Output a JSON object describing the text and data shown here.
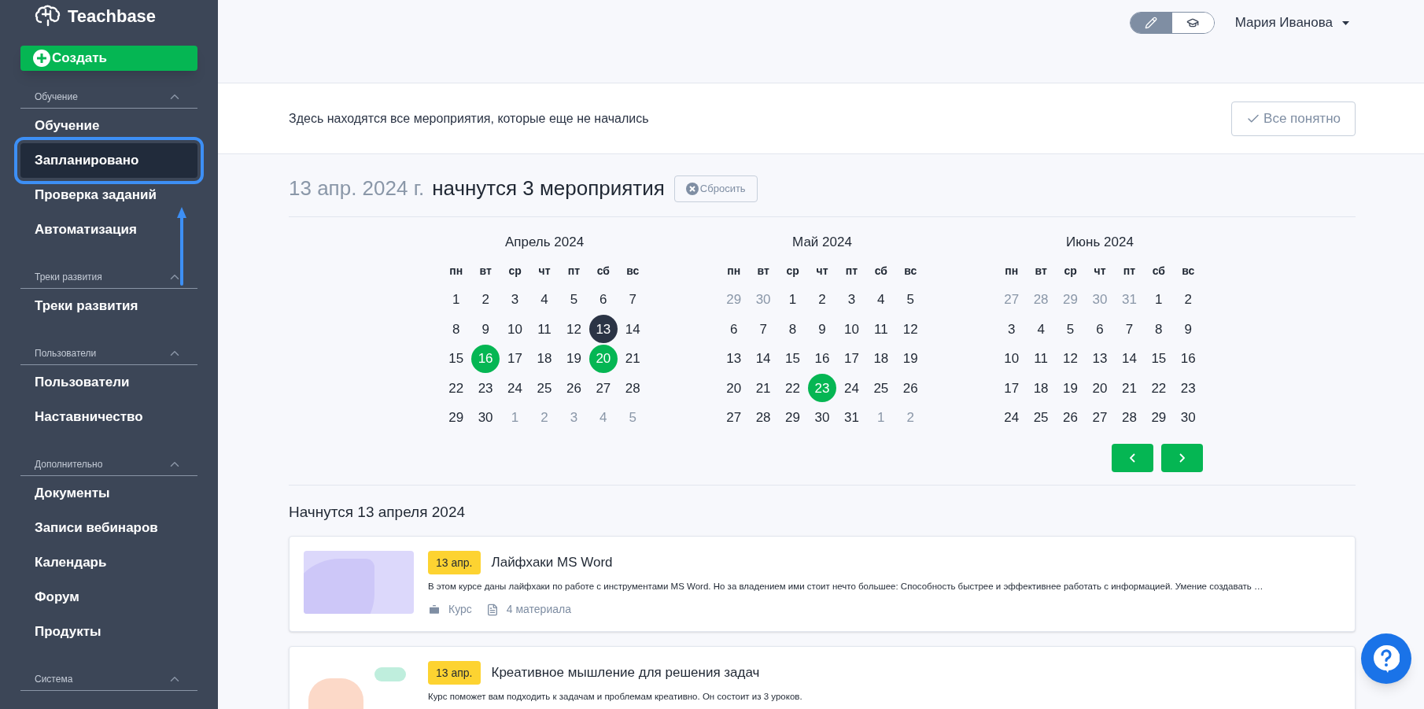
{
  "sidebar": {
    "brand": "Teachbase",
    "create_button": "Создать",
    "sections": [
      {
        "title": "Обучение",
        "expanded": true,
        "items": [
          {
            "label": "Обучение",
            "selected": false
          },
          {
            "label": "Запланировано",
            "selected": true
          },
          {
            "label": "Проверка заданий",
            "selected": false
          },
          {
            "label": "Автоматизация",
            "selected": false
          }
        ]
      },
      {
        "title": "Треки развития",
        "expanded": true,
        "items": [
          {
            "label": "Треки развития",
            "selected": false
          }
        ]
      },
      {
        "title": "Пользователи",
        "expanded": true,
        "items": [
          {
            "label": "Пользователи",
            "selected": false
          },
          {
            "label": "Наставничество",
            "selected": false
          }
        ]
      },
      {
        "title": "Дополнительно",
        "expanded": true,
        "items": [
          {
            "label": "Документы",
            "selected": false
          },
          {
            "label": "Записи вебинаров",
            "selected": false
          },
          {
            "label": "Календарь",
            "selected": false
          },
          {
            "label": "Форум",
            "selected": false
          },
          {
            "label": "Продукты",
            "selected": false
          }
        ]
      },
      {
        "title": "Система",
        "expanded": true
      }
    ]
  },
  "header": {
    "modes": [
      {
        "selected": true
      },
      {
        "selected": false
      }
    ],
    "user": "Мария Иванова"
  },
  "banner": {
    "text": "Здесь находятся все мероприятия, которые еще не начались",
    "button": "Все понятно"
  },
  "summary": {
    "date": "13 апр. 2024 г.",
    "text": "начнутся 3 мероприятия",
    "reset_button": "Сбросить"
  },
  "calendar": {
    "months": [
      {
        "title": "Апрель 2024",
        "weekdays": [
          "пн",
          "вт",
          "ср",
          "чт",
          "пт",
          "сб",
          "вс"
        ],
        "weeks": [
          [
            {
              "d": "1",
              "kind": "day"
            },
            {
              "d": "2",
              "kind": "day"
            },
            {
              "d": "3",
              "kind": "day"
            },
            {
              "d": "4",
              "kind": "day"
            },
            {
              "d": "5",
              "kind": "day"
            },
            {
              "d": "6",
              "kind": "day"
            },
            {
              "d": "7",
              "kind": "day"
            }
          ],
          [
            {
              "d": "8",
              "kind": "day"
            },
            {
              "d": "9",
              "kind": "day"
            },
            {
              "d": "10",
              "kind": "day"
            },
            {
              "d": "11",
              "kind": "day"
            },
            {
              "d": "12",
              "kind": "day"
            },
            {
              "d": "13",
              "kind": "selected"
            },
            {
              "d": "14",
              "kind": "day"
            }
          ],
          [
            {
              "d": "15",
              "kind": "day"
            },
            {
              "d": "16",
              "kind": "event"
            },
            {
              "d": "17",
              "kind": "day"
            },
            {
              "d": "18",
              "kind": "day"
            },
            {
              "d": "19",
              "kind": "day"
            },
            {
              "d": "20",
              "kind": "event"
            },
            {
              "d": "21",
              "kind": "day"
            }
          ],
          [
            {
              "d": "22",
              "kind": "day"
            },
            {
              "d": "23",
              "kind": "day"
            },
            {
              "d": "24",
              "kind": "day"
            },
            {
              "d": "25",
              "kind": "day"
            },
            {
              "d": "26",
              "kind": "day"
            },
            {
              "d": "27",
              "kind": "day"
            },
            {
              "d": "28",
              "kind": "day"
            }
          ],
          [
            {
              "d": "29",
              "kind": "day"
            },
            {
              "d": "30",
              "kind": "day"
            },
            {
              "d": "1",
              "kind": "outside"
            },
            {
              "d": "2",
              "kind": "outside"
            },
            {
              "d": "3",
              "kind": "outside"
            },
            {
              "d": "4",
              "kind": "outside"
            },
            {
              "d": "5",
              "kind": "outside"
            }
          ]
        ]
      },
      {
        "title": "Май 2024",
        "weekdays": [
          "пн",
          "вт",
          "ср",
          "чт",
          "пт",
          "сб",
          "вс"
        ],
        "weeks": [
          [
            {
              "d": "29",
              "kind": "outside"
            },
            {
              "d": "30",
              "kind": "outside"
            },
            {
              "d": "1",
              "kind": "day"
            },
            {
              "d": "2",
              "kind": "day"
            },
            {
              "d": "3",
              "kind": "day"
            },
            {
              "d": "4",
              "kind": "day"
            },
            {
              "d": "5",
              "kind": "day"
            }
          ],
          [
            {
              "d": "6",
              "kind": "day"
            },
            {
              "d": "7",
              "kind": "day"
            },
            {
              "d": "8",
              "kind": "day"
            },
            {
              "d": "9",
              "kind": "day"
            },
            {
              "d": "10",
              "kind": "day"
            },
            {
              "d": "11",
              "kind": "day"
            },
            {
              "d": "12",
              "kind": "day"
            }
          ],
          [
            {
              "d": "13",
              "kind": "day"
            },
            {
              "d": "14",
              "kind": "day"
            },
            {
              "d": "15",
              "kind": "day"
            },
            {
              "d": "16",
              "kind": "day"
            },
            {
              "d": "17",
              "kind": "day"
            },
            {
              "d": "18",
              "kind": "day"
            },
            {
              "d": "19",
              "kind": "day"
            }
          ],
          [
            {
              "d": "20",
              "kind": "day"
            },
            {
              "d": "21",
              "kind": "day"
            },
            {
              "d": "22",
              "kind": "day"
            },
            {
              "d": "23",
              "kind": "event"
            },
            {
              "d": "24",
              "kind": "day"
            },
            {
              "d": "25",
              "kind": "day"
            },
            {
              "d": "26",
              "kind": "day"
            }
          ],
          [
            {
              "d": "27",
              "kind": "day"
            },
            {
              "d": "28",
              "kind": "day"
            },
            {
              "d": "29",
              "kind": "day"
            },
            {
              "d": "30",
              "kind": "day"
            },
            {
              "d": "31",
              "kind": "day"
            },
            {
              "d": "1",
              "kind": "outside"
            },
            {
              "d": "2",
              "kind": "outside"
            }
          ]
        ]
      },
      {
        "title": "Июнь 2024",
        "weekdays": [
          "пн",
          "вт",
          "ср",
          "чт",
          "пт",
          "сб",
          "вс"
        ],
        "weeks": [
          [
            {
              "d": "27",
              "kind": "outside"
            },
            {
              "d": "28",
              "kind": "outside"
            },
            {
              "d": "29",
              "kind": "outside"
            },
            {
              "d": "30",
              "kind": "outside"
            },
            {
              "d": "31",
              "kind": "outside"
            },
            {
              "d": "1",
              "kind": "day"
            },
            {
              "d": "2",
              "kind": "day"
            }
          ],
          [
            {
              "d": "3",
              "kind": "day"
            },
            {
              "d": "4",
              "kind": "day"
            },
            {
              "d": "5",
              "kind": "day"
            },
            {
              "d": "6",
              "kind": "day"
            },
            {
              "d": "7",
              "kind": "day"
            },
            {
              "d": "8",
              "kind": "day"
            },
            {
              "d": "9",
              "kind": "day"
            }
          ],
          [
            {
              "d": "10",
              "kind": "day"
            },
            {
              "d": "11",
              "kind": "day"
            },
            {
              "d": "12",
              "kind": "day"
            },
            {
              "d": "13",
              "kind": "day"
            },
            {
              "d": "14",
              "kind": "day"
            },
            {
              "d": "15",
              "kind": "day"
            },
            {
              "d": "16",
              "kind": "day"
            }
          ],
          [
            {
              "d": "17",
              "kind": "day"
            },
            {
              "d": "18",
              "kind": "day"
            },
            {
              "d": "19",
              "kind": "day"
            },
            {
              "d": "20",
              "kind": "day"
            },
            {
              "d": "21",
              "kind": "day"
            },
            {
              "d": "22",
              "kind": "day"
            },
            {
              "d": "23",
              "kind": "day"
            }
          ],
          [
            {
              "d": "24",
              "kind": "day"
            },
            {
              "d": "25",
              "kind": "day"
            },
            {
              "d": "26",
              "kind": "day"
            },
            {
              "d": "27",
              "kind": "day"
            },
            {
              "d": "28",
              "kind": "day"
            },
            {
              "d": "29",
              "kind": "day"
            },
            {
              "d": "30",
              "kind": "day"
            }
          ]
        ]
      }
    ]
  },
  "events": {
    "heading": "Начнутся 13 апреля 2024",
    "items": [
      {
        "date": "13 апр.",
        "title": "Лайфхаки MS Word",
        "description": "В этом курсе даны лайфхаки по работе с инструментами MS Word. Но за владением ими стоит нечто большее: Способность быстрее и эффективнее работать с информацией. Умение создавать …",
        "type": "Курс",
        "materials": "4 материала"
      },
      {
        "date": "13 апр.",
        "title": "Креативное мышление для решения задач",
        "description": "Курс поможет вам подходить к задачам и проблемам креативно. Он состоит из 3 уроков."
      }
    ]
  }
}
